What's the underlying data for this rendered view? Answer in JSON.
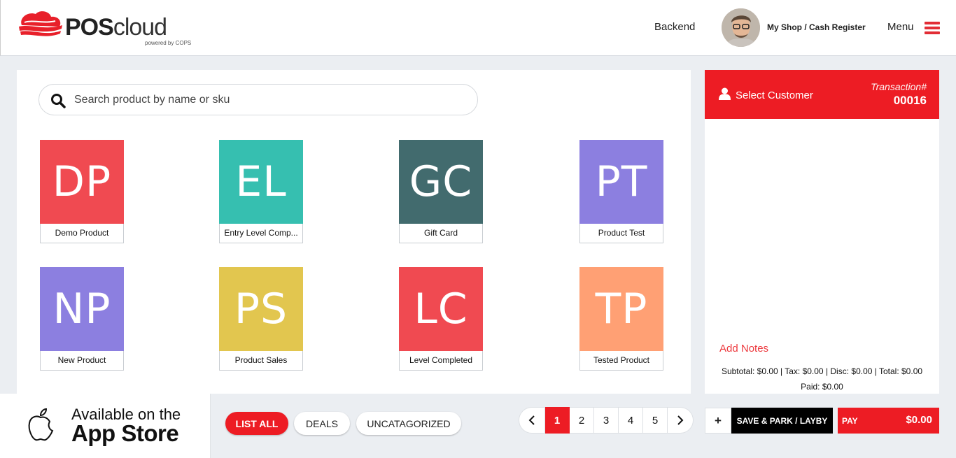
{
  "header": {
    "logo": {
      "brand_bold": "POS",
      "brand_light": "cloud",
      "tagline": "powered by COPS"
    },
    "backend_label": "Backend",
    "shop_label": "My Shop / Cash Register",
    "menu_label": "Menu"
  },
  "search": {
    "placeholder": "Search product by name or sku",
    "value": ""
  },
  "products": [
    {
      "initials": "DP",
      "name": "Demo Product",
      "color": "#f04a51"
    },
    {
      "initials": "EL",
      "name": "Entry Level Comp...",
      "color": "#36bfb0"
    },
    {
      "initials": "GC",
      "name": "Gift Card",
      "color": "#426b6e"
    },
    {
      "initials": "PT",
      "name": "Product Test",
      "color": "#8c7fe0"
    },
    {
      "initials": "NP",
      "name": "New Product",
      "color": "#8c7fe0"
    },
    {
      "initials": "PS",
      "name": "Product Sales",
      "color": "#e2c64f"
    },
    {
      "initials": "LC",
      "name": "Level Completed",
      "color": "#f04a51"
    },
    {
      "initials": "TP",
      "name": "Tested Product",
      "color": "#ffa074"
    }
  ],
  "cart": {
    "select_customer": "Select Customer",
    "transaction_label": "Transaction#",
    "transaction_number": "00016",
    "add_notes": "Add Notes",
    "totals_line": "Subtotal: $0.00 | Tax: $0.00 | Disc: $0.00 | Total: $0.00",
    "paid_line": "Paid: $0.00"
  },
  "appstore": {
    "line1": "Available on the",
    "line2": "App Store"
  },
  "filters": {
    "list_all": "LIST ALL",
    "deals": "DEALS",
    "uncategorized": "UNCATAGORIZED"
  },
  "pagination": {
    "prev": "‹",
    "next": "›",
    "pages": [
      "1",
      "2",
      "3",
      "4",
      "5"
    ],
    "current": "1"
  },
  "actions": {
    "plus": "+",
    "save_park": "SAVE & PARK / LAYBY",
    "pay_label": "PAY",
    "pay_amount": "$0.00"
  },
  "colors": {
    "accent": "#ed1c24",
    "hamburger": "#e22d35"
  }
}
